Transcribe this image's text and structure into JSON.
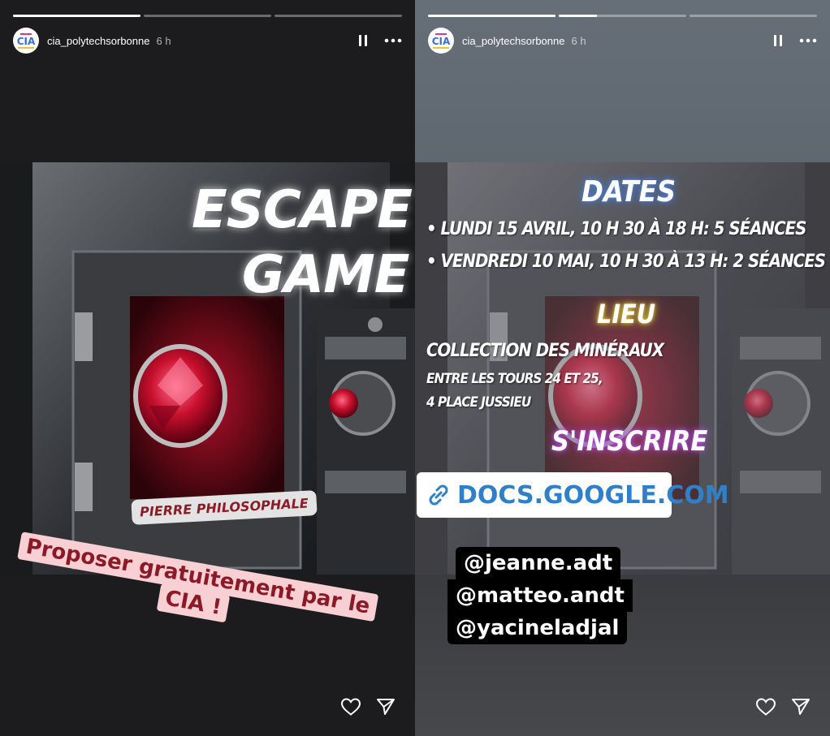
{
  "stories": [
    {
      "progress": [
        1,
        0,
        0
      ],
      "username": "cia_polytechsorbonne",
      "time": "6 h",
      "avatar_text": "CIA",
      "poster_title_line1": "ESCAPE",
      "poster_title_line2": "GAME",
      "poster_badge": "PIERRE PHILOSOPHALE",
      "caption_lines": [
        "Proposer gratuitement par le",
        "CIA !"
      ]
    },
    {
      "progress": [
        1,
        0.3,
        0
      ],
      "username": "cia_polytechsorbonne",
      "time": "6 h",
      "avatar_text": "CIA",
      "dates_heading": "DATES",
      "dates_line1": "• LUNDI 15 AVRIL, 10 H 30 À 18 H:  5 SÉANCES",
      "dates_line2": "• VENDREDI 10 MAI, 10 H 30 À 13 H: 2 SÉANCES",
      "lieu_heading": "LIEU",
      "lieu_line1": "COLLECTION DES MINÉRAUX",
      "lieu_line2": "ENTRE LES TOURS 24 ET 25,",
      "lieu_line3": "4 PLACE JUSSIEU",
      "signup": "S'INSCRIRE",
      "link_text": "DOCS.GOOGLE.COM",
      "mentions": [
        "@jeanne.adt",
        "@matteo.andt",
        "@yacineladjal"
      ]
    }
  ],
  "icons": {
    "pause": "pause-icon",
    "more": "more-icon",
    "like": "heart-icon",
    "share": "send-icon",
    "link": "link-icon"
  },
  "colors": {
    "caption_text": "#8b1a28",
    "caption_bg": "#f8d0d4",
    "link_blue": "#2f80c9",
    "dates_glow": "#4b7bd8",
    "lieu_glow": "#d8c83a",
    "signup_glow": "#b04be0"
  }
}
